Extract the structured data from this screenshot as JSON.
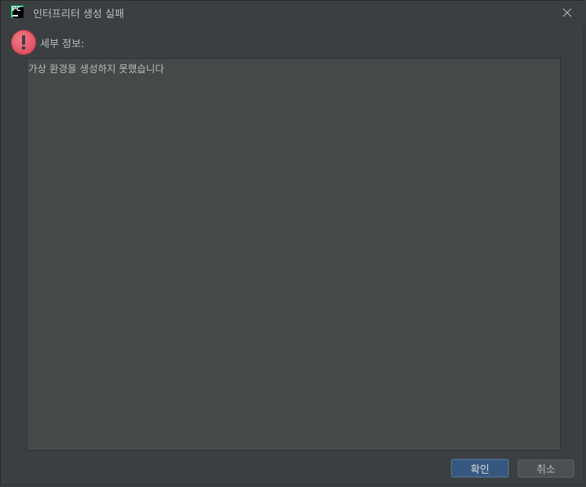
{
  "window": {
    "title": "인터프리터 생성 실패",
    "logo_text": "PC",
    "close_icon": "close-icon",
    "colors": {
      "background": "#3c3f41",
      "text": "#bbbbbb",
      "error": "#e55b6a",
      "primary_button": "#365880",
      "logo_accent": "#21d789"
    }
  },
  "message": {
    "icon": "error-icon",
    "label": "세부 정보:",
    "details": "가상 환경을 생성하지 못했습니다"
  },
  "buttons": {
    "ok_label": "확인",
    "cancel_label": "취소"
  }
}
